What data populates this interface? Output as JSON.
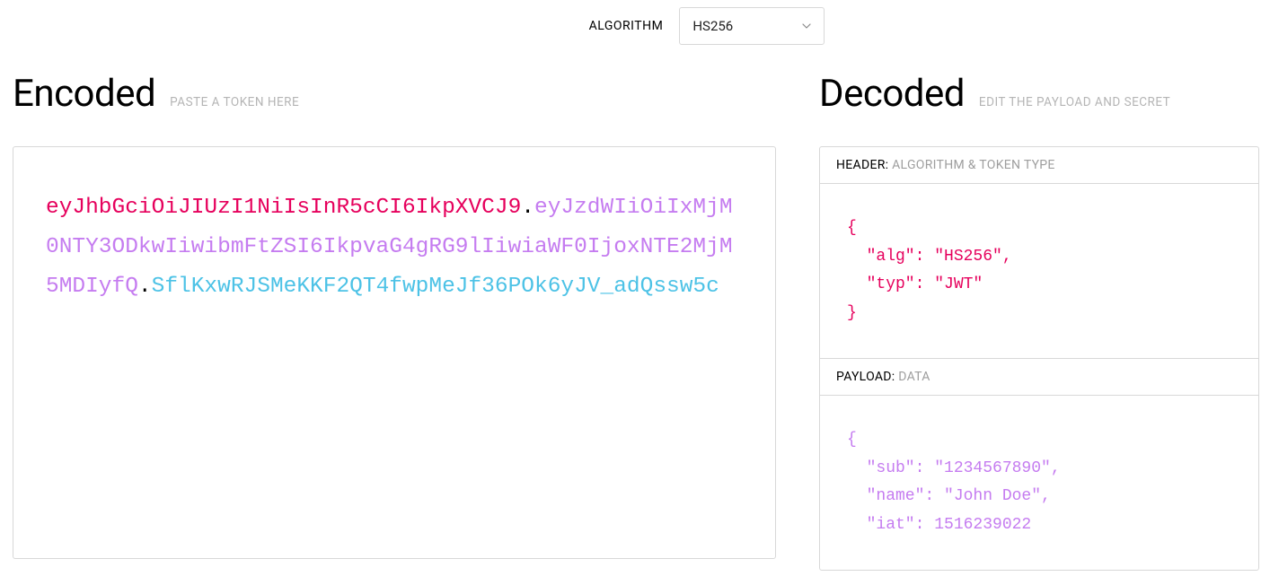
{
  "algorithm": {
    "label": "ALGORITHM",
    "selected": "HS256"
  },
  "encoded": {
    "title": "Encoded",
    "subtitle": "PASTE A TOKEN HERE",
    "jwt": {
      "header": "eyJhbGciOiJIUzI1NiIsInR5cCI6IkpXVCJ9",
      "payload": "eyJzdWIiOiIxMjM0NTY3ODkwIiwibmFtZSI6IkpvaG4gRG9lIiwiaWF0IjoxNTE2MjM5MDIyfQ",
      "signature": "SflKxwRJSMeKKF2QT4fwpMeJf36POk6yJV_adQssw5c"
    }
  },
  "decoded": {
    "title": "Decoded",
    "subtitle": "EDIT THE PAYLOAD AND SECRET",
    "header_section": {
      "label_main": "HEADER:",
      "label_sub": "ALGORITHM & TOKEN TYPE",
      "code": "{\n  \"alg\": \"HS256\",\n  \"typ\": \"JWT\"\n}"
    },
    "payload_section": {
      "label_main": "PAYLOAD:",
      "label_sub": "DATA",
      "code": "{\n  \"sub\": \"1234567890\",\n  \"name\": \"John Doe\",\n  \"iat\": 1516239022"
    }
  }
}
